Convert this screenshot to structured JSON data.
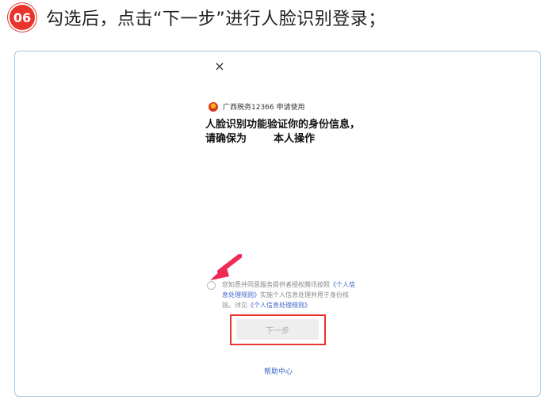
{
  "step": {
    "number": "06",
    "instruction": "勾选后，点击“下一步”进行人脸识别登录；"
  },
  "dialog": {
    "close_symbol": "×",
    "app_label": "广西税务12366 申请使用",
    "title_line1": "人脸识别功能验证你的身份信息，",
    "title_line2_prefix": "请确保为",
    "title_line2_suffix": "本人操作",
    "consent_prefix": "您知悉并同意服务提供者授权腾讯按照",
    "consent_link1": "《个人信息处理规则》",
    "consent_middle": "实施个人信息处理并用于身份核验。详见",
    "consent_link2": "《个人信息处理规则》",
    "next_button": "下一步",
    "help_link": "帮助中心"
  },
  "colors": {
    "highlight_red": "#e8342c",
    "frame_border": "#9ec8ea",
    "link_blue": "#3b63c8",
    "arrow_pink": "#ee2a55"
  }
}
